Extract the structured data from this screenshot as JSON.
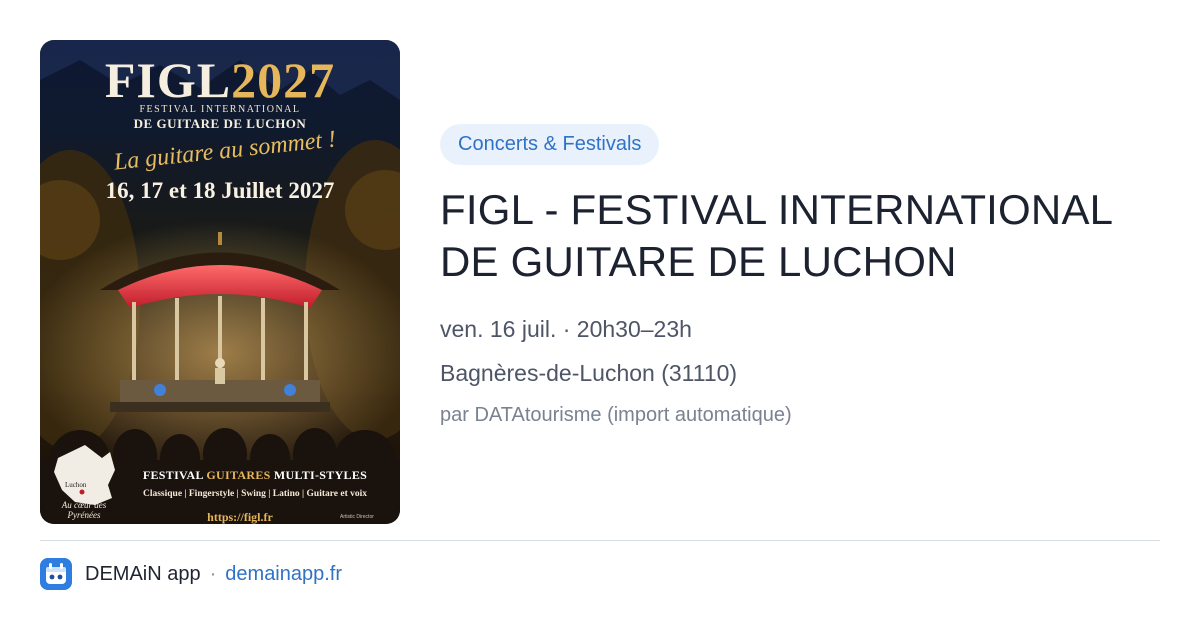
{
  "poster": {
    "title_main": "FIGL",
    "title_year": "2027",
    "subtitle_line1": "FESTIVAL INTERNATIONAL",
    "subtitle_line2": "DE GUITARE DE LUCHON",
    "slogan": "La guitare au sommet !",
    "dates": "16, 17 et 18 Juillet 2027",
    "multi_prefix": "FESTIVAL",
    "multi_highlight": "GUITARES",
    "multi_suffix": "MULTI-STYLES",
    "styles": "Classique  |  Fingerstyle  |  Swing  |  Latino  |  Guitare et voix",
    "url": "https://figl.fr",
    "map_label": "Luchon",
    "map_caption": "Au cœur des Pyrénées",
    "credit": "Artistic Director"
  },
  "event": {
    "category": "Concerts & Festivals",
    "title": "FIGL - FESTIVAL INTERNATIONAL DE GUITARE DE LUCHON",
    "when": "ven. 16 juil. · 20h30–23h",
    "where": "Bagnères-de-Luchon (31110)",
    "source": "par DATAtourisme (import automatique)"
  },
  "footer": {
    "app_name": "DEMAiN app",
    "separator": "·",
    "site": "demainapp.fr"
  },
  "colors": {
    "accent": "#2f72c6",
    "tag_bg": "#e9f2fc",
    "poster_gold": "#e6b65a"
  }
}
